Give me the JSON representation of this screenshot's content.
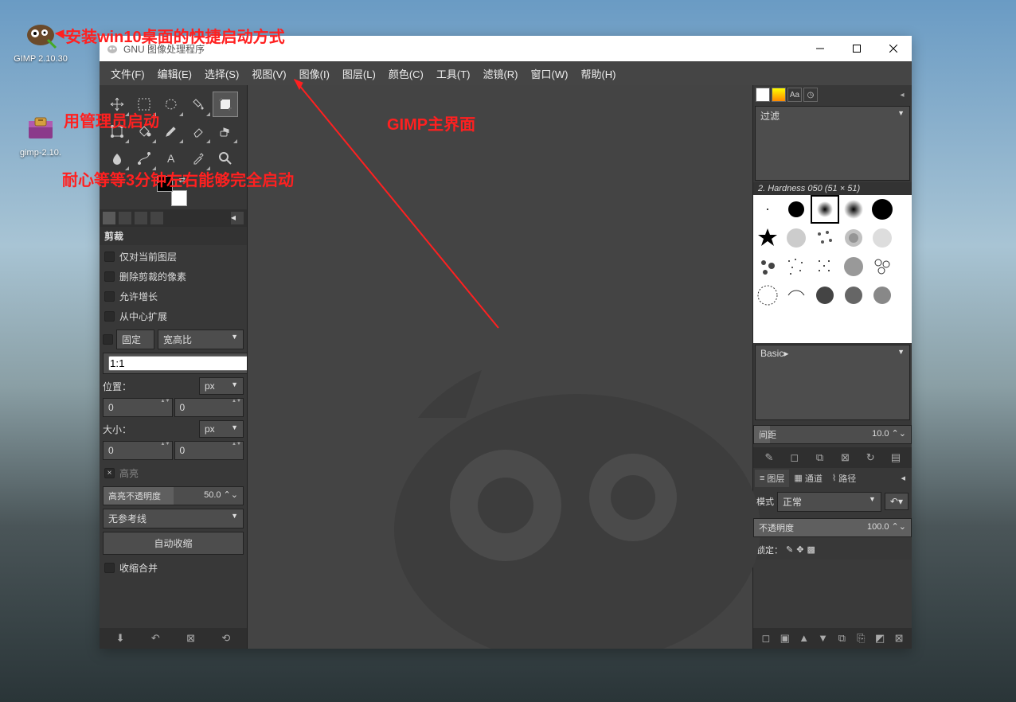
{
  "desktop": {
    "icon1": "GIMP 2.10.30",
    "icon2": "gimp-2.10."
  },
  "annotations": {
    "a1": "安装win10桌面的快捷启动方式",
    "a2": "用管理员启动",
    "a3": "耐心等等3分钟左右能够完全启动",
    "a4": "GIMP主界面"
  },
  "window": {
    "title": "GNU 图像处理程序"
  },
  "menu": {
    "file": "文件(F)",
    "edit": "编辑(E)",
    "select": "选择(S)",
    "view": "视图(V)",
    "image": "图像(I)",
    "layer": "图层(L)",
    "colors": "颜色(C)",
    "tools": "工具(T)",
    "filters": "滤镜(R)",
    "windows": "窗口(W)",
    "help": "帮助(H)"
  },
  "tool_section": "剪裁",
  "crop": {
    "only_layer": "仅对当前图层",
    "delete_px": "删除剪裁的像素",
    "allow_grow": "允许增长",
    "center_expand": "从中心扩展",
    "fixed": "固定",
    "aspect": "宽高比",
    "ratio": "1:1",
    "position": "位置：",
    "unit_px": "px",
    "pos_x": "0",
    "pos_y": "0",
    "size": "大小：",
    "size_w": "0",
    "size_h": "0",
    "highlight": "高亮",
    "hl_opacity_label": "高亮不透明度",
    "hl_opacity_val": "50.0",
    "guides": "无参考线",
    "auto_shrink": "自动收缩",
    "shrink_merge": "收缩合并"
  },
  "right": {
    "filter": "过滤",
    "brush_name": "2. Hardness 050 (51 × 51)",
    "preset": "Basic▸",
    "spacing_label": "间距",
    "spacing_val": "10.0",
    "layers": "图层",
    "channels": "通道",
    "paths": "路径",
    "mode": "模式",
    "normal": "正常",
    "opacity": "不透明度",
    "opacity_val": "100.0",
    "lock": "锁定："
  }
}
